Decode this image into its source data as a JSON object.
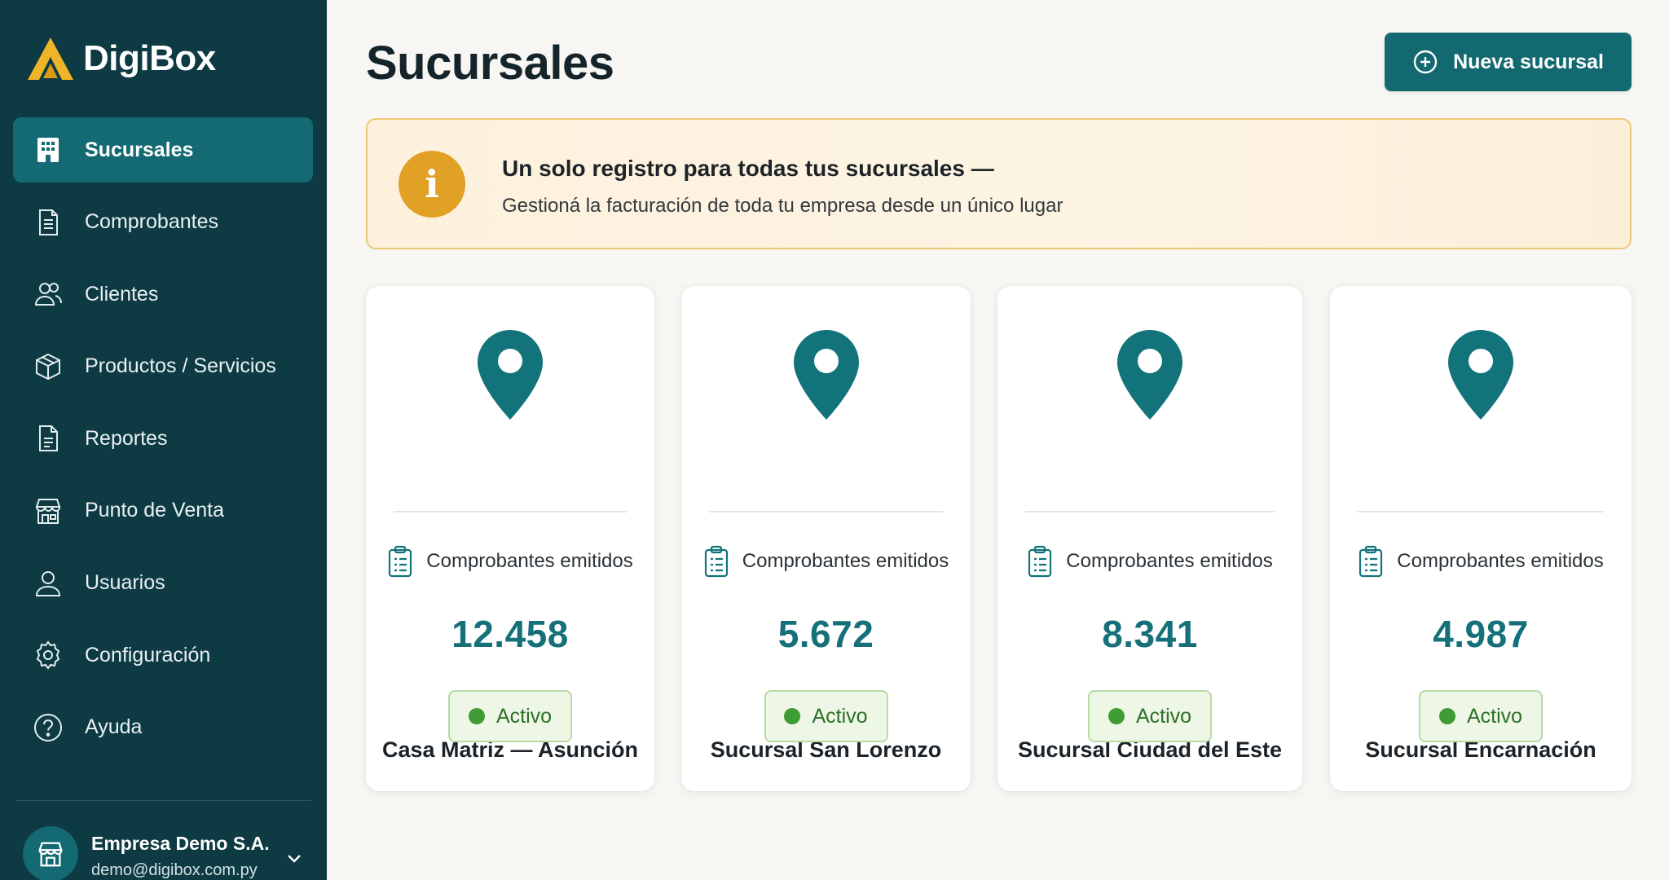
{
  "app": {
    "brand": "DigiBox"
  },
  "sidebar": {
    "items": [
      {
        "label": "Sucursales",
        "icon": "building-icon",
        "active": true
      },
      {
        "label": "Comprobantes",
        "icon": "receipt-icon",
        "active": false
      },
      {
        "label": "Clientes",
        "icon": "users-icon",
        "active": false
      },
      {
        "label": "Productos / Servicios",
        "icon": "box-icon",
        "active": false
      },
      {
        "label": "Reportes",
        "icon": "document-icon",
        "active": false
      },
      {
        "label": "Punto de Venta",
        "icon": "store-icon",
        "active": false
      },
      {
        "label": "Usuarios",
        "icon": "user-icon",
        "active": false
      },
      {
        "label": "Configuración",
        "icon": "gear-icon",
        "active": false
      },
      {
        "label": "Ayuda",
        "icon": "help-icon",
        "active": false
      }
    ],
    "account": {
      "name": "Empresa Demo S.A.",
      "email": "demo@digibox.com.py",
      "icon": "store-icon"
    }
  },
  "header": {
    "title": "Sucursales",
    "new_button_label": "Nueva sucursal"
  },
  "banner": {
    "icon_glyph": "i",
    "title": "Un solo registro para todas tus sucursales —",
    "text": "Gestioná la facturación de toda tu empresa desde un único lugar"
  },
  "branches": [
    {
      "name": "Casa Matriz — Asunción",
      "metric_label": "Comprobantes emitidos",
      "count": "12.458",
      "status": "Activo"
    },
    {
      "name": "Sucursal San Lorenzo",
      "metric_label": "Comprobantes emitidos",
      "count": "5.672",
      "status": "Activo"
    },
    {
      "name": "Sucursal Ciudad del Este",
      "metric_label": "Comprobantes emitidos",
      "count": "8.341",
      "status": "Activo"
    },
    {
      "name": "Sucursal Encarnación",
      "metric_label": "Comprobantes emitidos",
      "count": "4.987",
      "status": "Activo"
    }
  ],
  "colors": {
    "sidebar": "#0d3a43",
    "accent": "#12696f",
    "brand_logo": "#f0b429",
    "banner_icon": "#e0a124",
    "status_green": "#3f9b34"
  }
}
